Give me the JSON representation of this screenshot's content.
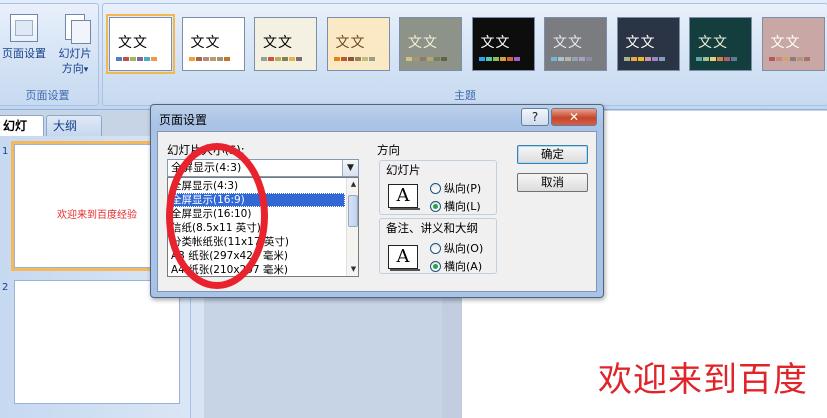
{
  "ribbon": {
    "page_setup_button": "页面设置",
    "orientation_button_line1": "幻灯片",
    "orientation_button_line2": "方向",
    "orientation_arrow": "▾",
    "group_page_setup": "页面设置",
    "group_themes": "主题",
    "theme_label": "文文",
    "themes": [
      {
        "bg": "#ffffff",
        "fg": "#000000",
        "bars": [
          "#4f81bd",
          "#c0504d",
          "#9bbb59",
          "#8064a2",
          "#4bacc6",
          "#f79646"
        ]
      },
      {
        "bg": "#ffffff",
        "fg": "#000000",
        "bars": [
          "#f0a22e",
          "#a5644e",
          "#b58b80",
          "#c3986d",
          "#a19574",
          "#c17529"
        ]
      },
      {
        "bg": "#f4f1e2",
        "fg": "#000000",
        "bars": [
          "#93a299",
          "#cf543f",
          "#b5ae53",
          "#848058",
          "#e8b54d",
          "#786c71"
        ]
      },
      {
        "bg": "#fbe9c6",
        "fg": "#6b4a1e",
        "bars": [
          "#e48312",
          "#bd582c",
          "#865640",
          "#9b8357",
          "#c2bc80",
          "#94a088"
        ]
      },
      {
        "bg": "#8d9388",
        "fg": "#f3f1d6",
        "bars": [
          "#d3c37a",
          "#a7956c",
          "#8a7c65",
          "#b0a96b",
          "#797e5e",
          "#5d6448"
        ]
      },
      {
        "bg": "#0d0d0d",
        "fg": "#ffffff",
        "bars": [
          "#2fa3ee",
          "#4bcaad",
          "#86c157",
          "#d99c3f",
          "#ce6633",
          "#a35dd1"
        ]
      },
      {
        "bg": "#7a7c80",
        "fg": "#e7e8ec",
        "bars": [
          "#6fb7d6",
          "#a3c4d2",
          "#b9b4a6",
          "#8ca7b3",
          "#a6a0c9",
          "#8d8da0"
        ]
      },
      {
        "bg": "#2b3444",
        "fg": "#ffffff",
        "bars": [
          "#a5b592",
          "#f3a447",
          "#e7bc29",
          "#d092a7",
          "#9c85c0",
          "#809ec2"
        ]
      },
      {
        "bg": "#143d3d",
        "fg": "#e9f2d4",
        "bars": [
          "#5ea7a7",
          "#a2c38f",
          "#e8d07a",
          "#d67e44",
          "#b15a74",
          "#5d7c99"
        ]
      },
      {
        "bg": "#c9a7a5",
        "fg": "#ffffff",
        "bars": [
          "#b8545b",
          "#c78779",
          "#d2a46c",
          "#8f7b7a",
          "#b1987f",
          "#a37567"
        ]
      }
    ]
  },
  "panes": {
    "tab_slides": "幻灯片",
    "tab_outline": "大纲",
    "slide1_number": "1",
    "slide2_number": "2",
    "slide1_text": "欢迎来到百度经验",
    "slide_big_text": "欢迎来到百度"
  },
  "dialog": {
    "title": "页面设置",
    "help": "?",
    "close": "✕",
    "size_label": "幻灯片大小(S):",
    "size_selected": "全屏显示(4:3)",
    "size_options": [
      "全屏显示(4:3)",
      "全屏显示(16:9)",
      "全屏显示(16:10)",
      "信纸(8.5x11 英寸)",
      "分类帐纸张(11x17 英寸)",
      "A3 纸张(297x420 毫米)",
      "A4 纸张(210x297 毫米)"
    ],
    "selected_index": 1,
    "orientation_title": "方向",
    "slides_group": "幻灯片",
    "notes_group": "备注、讲义和大纲",
    "portrait": "纵向(P)",
    "landscape": "横向(L)",
    "portrait_notes": "纵向(O)",
    "landscape_notes": "横向(A)",
    "slides_orientation": "landscape",
    "notes_orientation": "landscape",
    "ok": "确定",
    "cancel": "取消",
    "icon_letter": "A",
    "scroll_up": "▲",
    "scroll_down": "▼",
    "dropdown_arrow": "▼"
  }
}
